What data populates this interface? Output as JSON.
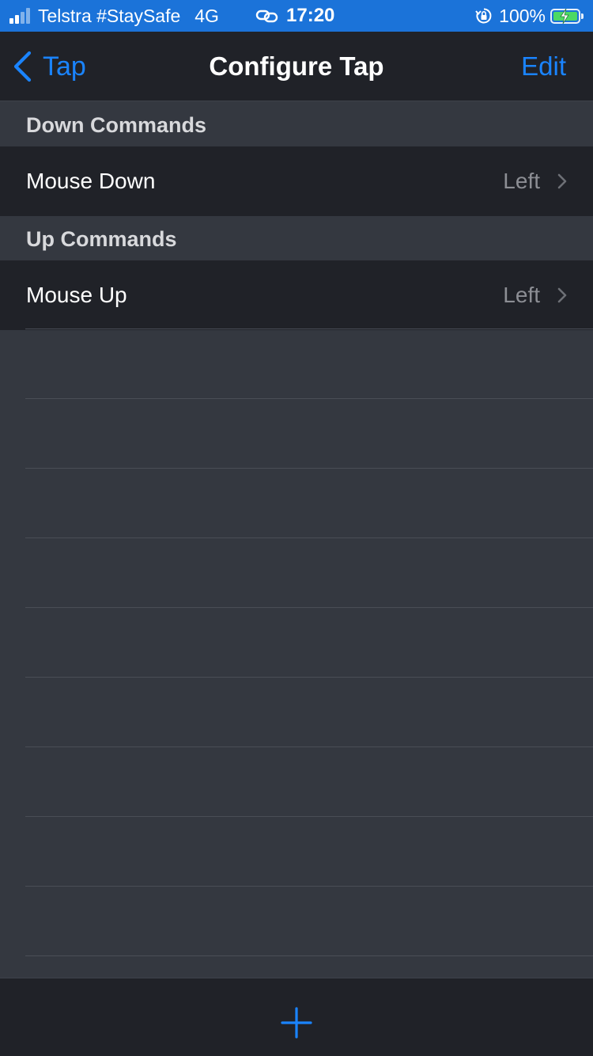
{
  "status_bar": {
    "carrier": "Telstra #StaySafe",
    "network": "4G",
    "time": "17:20",
    "battery_percent": "100%",
    "icons": [
      "signal-icon",
      "link-icon",
      "orientation-lock-icon",
      "battery-charging-icon"
    ]
  },
  "nav": {
    "back_label": "Tap",
    "title": "Configure Tap",
    "edit_label": "Edit"
  },
  "sections": [
    {
      "header": "Down Commands",
      "rows": [
        {
          "label": "Mouse Down",
          "value": "Left"
        }
      ]
    },
    {
      "header": "Up Commands",
      "rows": [
        {
          "label": "Mouse Up",
          "value": "Left"
        }
      ]
    }
  ],
  "toolbar": {
    "add_icon": "plus-icon"
  },
  "colors": {
    "status_bar_bg": "#1b73d9",
    "accent": "#1a84ff",
    "row_bg": "#202228",
    "group_bg": "#343840",
    "battery_fill": "#4cd964"
  }
}
